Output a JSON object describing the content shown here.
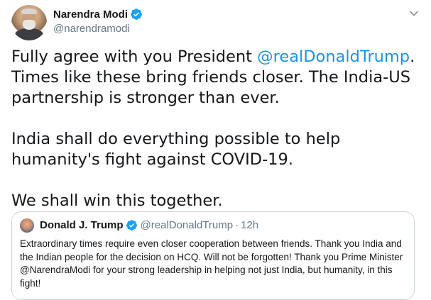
{
  "author": {
    "name": "Narendra Modi",
    "handle": "@narendramodi",
    "verified": true
  },
  "tweet": {
    "para1_before": "Fully agree with you President ",
    "para1_mention": "@realDonaldTrump",
    "para1_after": ". Times like these bring friends closer. The India-US partnership is stronger than ever.",
    "para2": "India shall do everything possible to help humanity's fight against COVID-19.",
    "para3": "We shall win this together."
  },
  "quoted": {
    "name": "Donald J. Trump",
    "handle": "@realDonaldTrump",
    "separator": "·",
    "time": "12h",
    "verified": true,
    "text": "Extraordinary times require even closer cooperation between friends. Thank you India and the Indian people for the decision on HCQ. Will not be forgotten! Thank you Prime Minister @NarendraModi for your strong leadership in helping not just India, but humanity, in this fight!"
  },
  "icons": {
    "verified": "verified-badge-icon",
    "menu": "chevron-down-icon"
  },
  "colors": {
    "link": "#1b95e0",
    "verified": "#1da1f2",
    "secondary_text": "#657786",
    "border": "#ccd6dd"
  }
}
